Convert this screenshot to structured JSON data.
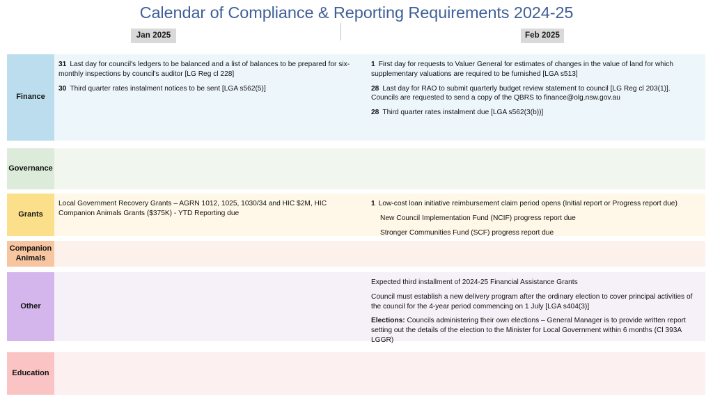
{
  "page_title": "Calendar of Compliance & Reporting Requirements 2024-25",
  "title_color": "#3F5F98",
  "columns": [
    {
      "id": "jan",
      "label": "Jan 2025"
    },
    {
      "id": "feb",
      "label": "Feb 2025"
    }
  ],
  "rows": [
    {
      "id": "finance",
      "label": "Finance",
      "label_color": "#BBDDEE",
      "body_color": "#EDF6FB",
      "jan": [
        {
          "day": "31",
          "text": "Last day for council's ledgers to be balanced and a list of balances to be prepared for six-monthly inspections by council's auditor [LG Reg cl 228]"
        },
        {
          "day": "30",
          "text": "Third quarter rates instalment notices to be sent [LGA s562(5)]"
        }
      ],
      "feb": [
        {
          "day": "1",
          "text": "First day for requests to Valuer General for estimates of changes in the value of land for which supplementary valuations are required to be furnished  [LGA s513]"
        },
        {
          "day": "28",
          "text": "Last day for RAO to submit quarterly budget review statement to council [LG Reg cl 203(1)]. Councils are requested to send a copy of the QBRS to finance@olg.nsw.gov.au"
        },
        {
          "day": "28",
          "text": "Third quarter rates instalment due [LGA s562(3(b))]"
        }
      ]
    },
    {
      "id": "governance",
      "label": "Governance",
      "label_color": "#DCEBDA",
      "body_color": "#F1F7EF",
      "jan": [],
      "feb": []
    },
    {
      "id": "grants",
      "label": "Grants",
      "label_color": "#FBDF8B",
      "body_color": "#FFF8E8",
      "jan": [
        {
          "day": "",
          "text": "Local Government Recovery Grants – AGRN 1012, 1025, 1030/34 and HIC $2M, HIC Companion Animals Grants ($375K) - YTD Reporting due"
        }
      ],
      "feb": [
        {
          "day": "1",
          "text": "Low-cost loan initiative reimbursement claim period opens (Initial report or Progress report due)"
        },
        {
          "day": "",
          "indented": true,
          "text": "New Council Implementation Fund (NCIF)  progress report due"
        },
        {
          "day": "",
          "indented": true,
          "text": "Stronger Communities Fund (SCF) progress report due"
        }
      ]
    },
    {
      "id": "companion-animals",
      "label": "Companion Animals",
      "label_color": "#F7C6A0",
      "body_color": "#FDF1EC",
      "jan": [],
      "feb": []
    },
    {
      "id": "other",
      "label": "Other",
      "label_color": "#D4B6EC",
      "body_color": "#F6F1F8",
      "jan": [],
      "feb": [
        {
          "day": "",
          "text": "Expected third installment of 2024-25 Financial Assistance Grants"
        },
        {
          "day": "",
          "text": "Council must establish a new delivery program after the ordinary election to cover principal activities of the council for the 4-year period commencing on 1 July [LGA s404(3)]"
        },
        {
          "day": "",
          "lead_bold": "Elections:",
          "text": "  Councils administering their own elections – General Manager is to provide written report setting out the details of the election to the Minister for Local Government within 6 months (Cl 393A LGGR)"
        }
      ]
    },
    {
      "id": "education",
      "label": "Education",
      "label_color": "#FAC4C4",
      "body_color": "#FDF0F0",
      "jan": [],
      "feb": []
    }
  ]
}
